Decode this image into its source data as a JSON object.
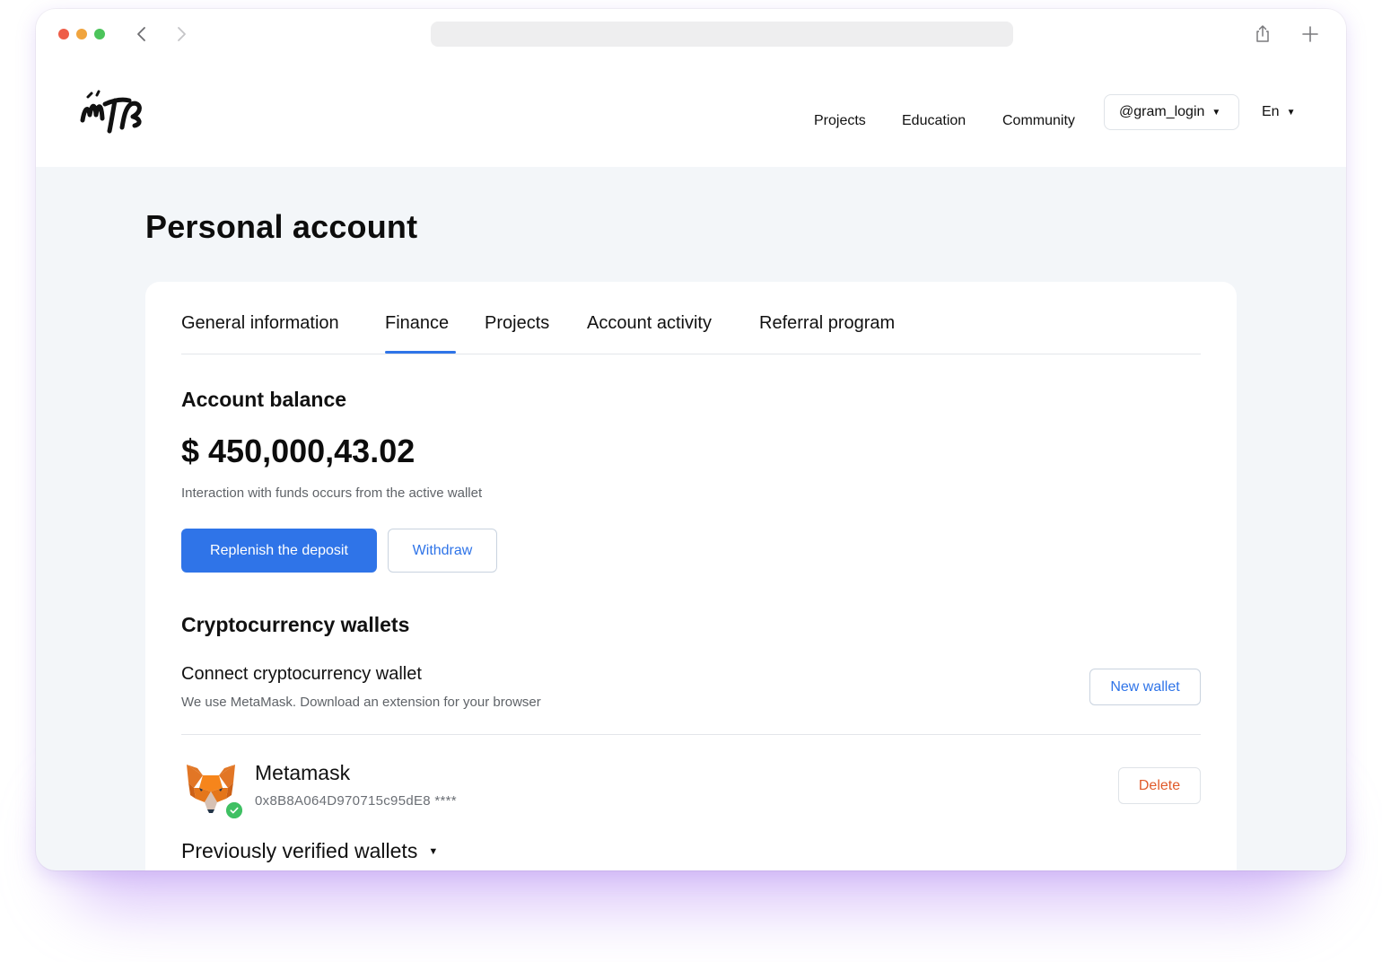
{
  "header": {
    "nav": {
      "projects": "Projects",
      "education": "Education",
      "community": "Community"
    },
    "user": "@gram_login",
    "language": "En",
    "caret": "▼"
  },
  "page": {
    "title": "Personal account"
  },
  "tabs": {
    "items": [
      "General information",
      "Finance",
      "Projects",
      "Account activity",
      "Referral program"
    ],
    "active": "Finance"
  },
  "balance": {
    "title": "Account balance",
    "amount": "$ 450,000,43.02",
    "note": "Interaction with funds occurs from the active wallet",
    "replenish_label": "Replenish the deposit",
    "withdraw_label": "Withdraw"
  },
  "wallets": {
    "title": "Cryptocurrency wallets",
    "connect_title": "Connect cryptocurrency wallet",
    "connect_note": "We use MetaMask. Download an extension for your browser",
    "new_wallet_label": "New wallet",
    "active_wallet": {
      "name": "Metamask",
      "address": "0x8B8A064D970715c95dE8 ****",
      "delete_label": "Delete",
      "icon": "metamask-fox-icon",
      "verified_icon": "check-icon"
    },
    "previous_label": "Previously verified wallets"
  },
  "colors": {
    "accent": "#2f74e8",
    "delete": "#e05a2a",
    "verified": "#3fc063"
  }
}
